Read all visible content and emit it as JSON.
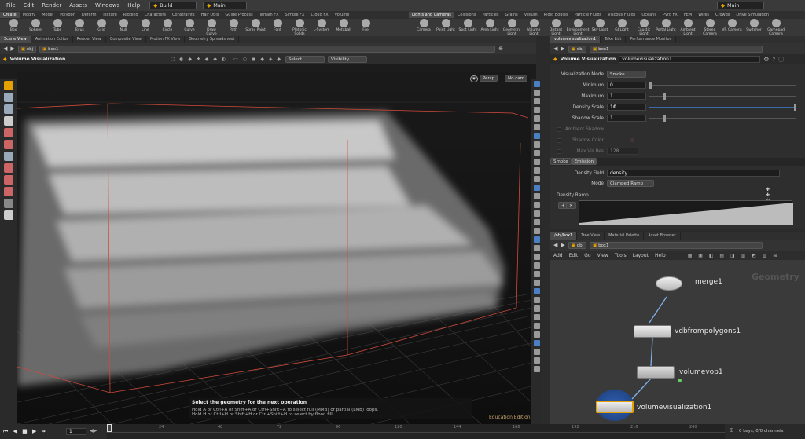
{
  "menu": [
    "File",
    "Edit",
    "Render",
    "Assets",
    "Windows",
    "Help"
  ],
  "desk": {
    "build": "Build",
    "main_left": "Main",
    "main_right": "Main"
  },
  "shelf_tabs_left": [
    "Create",
    "Modify",
    "Model",
    "Polygon",
    "Deform",
    "Texture",
    "Rigging",
    "Characters",
    "Constraints",
    "Hair Utils",
    "Guide Process",
    "Terrain FX",
    "Simple FX",
    "Cloud FX",
    "Volume"
  ],
  "shelf_tabs_right": [
    "Lights and Cameras",
    "Collisions",
    "Particles",
    "Grains",
    "Vellum",
    "Rigid Bodies",
    "Particle Fluids",
    "Viscous Fluids",
    "Oceans",
    "Pyro FX",
    "FEM",
    "Wires",
    "Crowds",
    "Drive Simulation"
  ],
  "tools_left": [
    "Box",
    "Sphere",
    "Tube",
    "Torus",
    "Grid",
    "Null",
    "Line",
    "Circle",
    "Curve",
    "Draw Curve",
    "Path",
    "Spray Paint",
    "Font",
    "Platonic Solids",
    "L-System",
    "Metaball",
    "File"
  ],
  "tools_right": [
    "Camera",
    "Point Light",
    "Spot Light",
    "Area Light",
    "Geometry Light",
    "Volume Light",
    "Distant Light",
    "Environment Light",
    "Sky Light",
    "GI Light",
    "Caustic Light",
    "Portal Light",
    "Ambient Light",
    "Stereo Camera",
    "VR Camera",
    "Switcher",
    "Gamepad Camera"
  ],
  "pane_tabs_left": [
    "Scene View",
    "Animation Editor",
    "Render View",
    "Composite View",
    "Motion FX View",
    "Geometry Spreadsheet"
  ],
  "pane_tabs_right": [
    "volumevisualization1",
    "Take List",
    "Performance Monitor"
  ],
  "viewer": {
    "path_obj": "obj",
    "path_node": "box1",
    "state_title": "Volume Visualization",
    "select_label": "Select",
    "visibility_label": "Visibility",
    "persp": "Persp",
    "nocam": "No cam",
    "edition": "Education Edition",
    "hint_title": "Select the geometry for the next operation",
    "hint_line1": "Hold A or Ctrl+A or Shift+A or Ctrl+Shift+A to select full (MMB) or partial (LMB) loops.",
    "hint_line2": "Hold H or Ctrl+H or Shift+H or Ctrl+Shift+H to select by flood fill."
  },
  "parms": {
    "node_type": "Volume Visualization",
    "node_name": "volumevisualization1",
    "path_obj": "obj",
    "path_node": "box1",
    "vis_mode_label": "Visualization Mode",
    "vis_mode_value": "Smoke",
    "minimum_label": "Minimum",
    "minimum_value": "0",
    "maximum_label": "Maximum",
    "maximum_value": "1",
    "density_scale_label": "Density Scale",
    "density_scale_value": "10",
    "shadow_scale_label": "Shadow Scale",
    "shadow_scale_value": "1",
    "ambient_shadow_label": "Ambient Shadow",
    "shadow_color_label": "Shadow Color",
    "max_res_label": "Max Vis Res",
    "max_res_value": "128",
    "tab_smoke": "Smoke",
    "tab_emission": "Emission",
    "density_field_label": "Density Field",
    "density_field_value": "density",
    "mode_label": "Mode",
    "mode_value": "Clamped Ramp",
    "density_ramp_label": "Density Ramp"
  },
  "network": {
    "tabs": [
      "/obj/box1",
      "Tree View",
      "Material Palette",
      "Asset Browser"
    ],
    "path_obj": "obj",
    "path_node": "box1",
    "menu": [
      "Add",
      "Edit",
      "Go",
      "View",
      "Tools",
      "Layout",
      "Help"
    ],
    "context_label": "Geometry",
    "nodes": [
      "merge1",
      "vdbfrompolygons1",
      "volumevop1",
      "volumevisualization1"
    ]
  },
  "timeline": {
    "frame": "1",
    "ticks": [
      "24",
      "48",
      "72",
      "96",
      "120",
      "144",
      "168",
      "192",
      "216",
      "240"
    ],
    "keys_label": "0 keys, 0/0 channels"
  },
  "colors": {
    "accent": "#e5a100",
    "bbox": "#d24b3c",
    "wire": "#7fb0e8"
  }
}
